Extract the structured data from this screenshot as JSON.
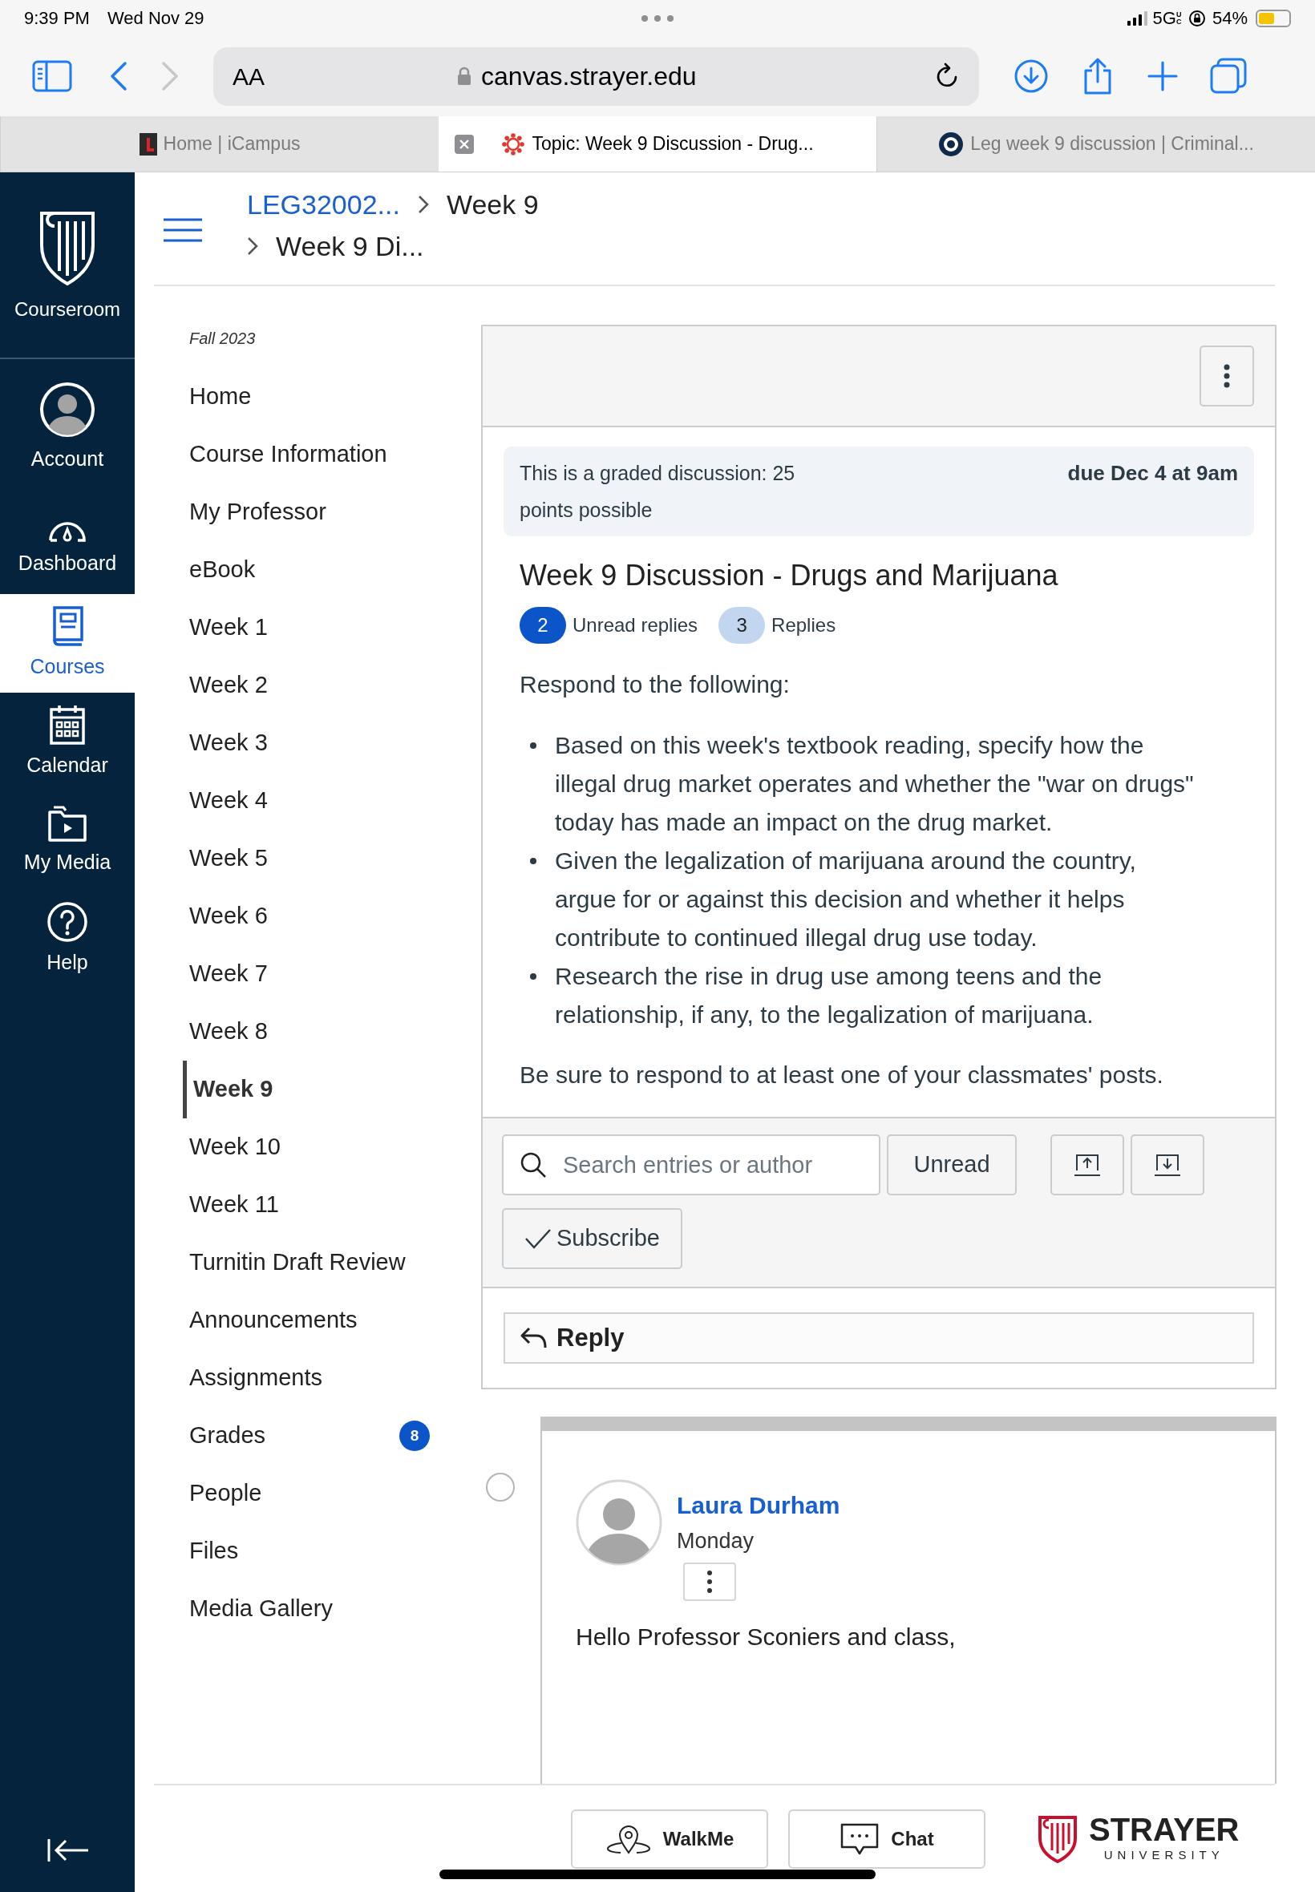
{
  "status_bar": {
    "time": "9:39 PM",
    "date": "Wed Nov 29",
    "network": "5G",
    "network_badge": "UC",
    "battery": {
      "text": "54%",
      "level": 0.54
    }
  },
  "browser": {
    "text_size": "AA",
    "url": "canvas.strayer.edu"
  },
  "tabs": [
    {
      "label": "Home | iCampus",
      "selected": false,
      "kind": "square"
    },
    {
      "label": "Topic: Week 9 Discussion - Drug...",
      "selected": true,
      "kind": "wheel"
    },
    {
      "label": "Leg week 9 discussion | Criminal...",
      "selected": false,
      "kind": "ring"
    }
  ],
  "nav_rail": {
    "brand": "Courseroom",
    "items": [
      {
        "label": "Account",
        "kind": "account",
        "selected": false
      },
      {
        "label": "Dashboard",
        "kind": "dashboard",
        "selected": false
      },
      {
        "label": "Courses",
        "kind": "courses",
        "selected": true
      },
      {
        "label": "Calendar",
        "kind": "calendar",
        "selected": false
      },
      {
        "label": "My Media",
        "kind": "media",
        "selected": false
      },
      {
        "label": "Help",
        "kind": "help",
        "selected": false
      }
    ]
  },
  "breadcrumb": [
    {
      "label": "LEG32002...",
      "kind": "link"
    },
    {
      "label": "Week 9",
      "kind": "text"
    },
    {
      "label": "Week 9 Di...",
      "kind": "text"
    }
  ],
  "course_nav": {
    "term": "Fall 2023",
    "items": [
      {
        "label": "Home",
        "selected": false
      },
      {
        "label": "Course Information",
        "selected": false
      },
      {
        "label": "My Professor",
        "selected": false
      },
      {
        "label": "eBook",
        "selected": false
      },
      {
        "label": "Week 1",
        "selected": false
      },
      {
        "label": "Week 2",
        "selected": false
      },
      {
        "label": "Week 3",
        "selected": false
      },
      {
        "label": "Week 4",
        "selected": false
      },
      {
        "label": "Week 5",
        "selected": false
      },
      {
        "label": "Week 6",
        "selected": false
      },
      {
        "label": "Week 7",
        "selected": false
      },
      {
        "label": "Week 8",
        "selected": false
      },
      {
        "label": "Week 9",
        "selected": true
      },
      {
        "label": "Week 10",
        "selected": false
      },
      {
        "label": "Week 11",
        "selected": false
      },
      {
        "label": "Turnitin Draft Review",
        "selected": false
      },
      {
        "label": "Announcements",
        "selected": false
      },
      {
        "label": "Assignments",
        "selected": false
      },
      {
        "label": "Grades",
        "selected": false,
        "badge": "8"
      },
      {
        "label": "People",
        "selected": false
      },
      {
        "label": "Files",
        "selected": false
      },
      {
        "label": "Media Gallery",
        "selected": false
      }
    ]
  },
  "discussion": {
    "graded_note": "This is a graded discussion: 25 points possible",
    "due": "due Dec 4 at 9am",
    "title": "Week 9 Discussion - Drugs and Marijuana",
    "unread_count": "2",
    "unread_label": "Unread replies",
    "replies_count": "3",
    "replies_label": "Replies",
    "intro": "Respond to the following:",
    "bullets": [
      "Based on this week's textbook reading, specify how the illegal drug market operates and whether the \"war on drugs\" today has made an impact on the drug market.",
      "Given the legalization of marijuana around the country, argue for or against this decision and whether it helps contribute to continued illegal drug use today.",
      "Research the rise in drug use among teens and the relationship, if any, to the legalization of marijuana."
    ],
    "closing": "Be sure to respond to at least one of your classmates' posts."
  },
  "toolbar": {
    "search_placeholder": "Search entries or author",
    "unread_button": "Unread",
    "subscribe": {
      "label": "Subscribe",
      "checked": true
    }
  },
  "reply_button": "Reply",
  "entries": [
    {
      "author": "Laura Durham",
      "time": "Monday",
      "text": "Hello Professor Sconiers and class,",
      "selected": false
    }
  ],
  "footer": {
    "walkme": "WalkMe",
    "chat": "Chat",
    "logo_name": "STRAYER",
    "logo_sub": "UNIVERSITY"
  }
}
